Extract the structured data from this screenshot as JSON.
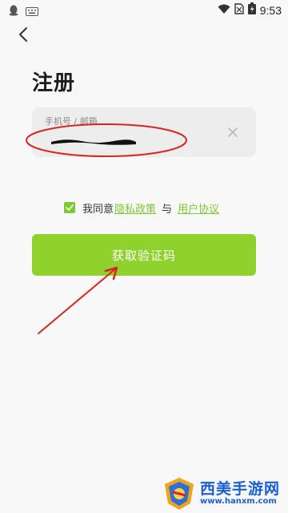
{
  "status_bar": {
    "time": "9:53"
  },
  "page": {
    "title": "注册"
  },
  "phone_input": {
    "label": "手机号 / 邮箱",
    "value": ""
  },
  "agreement": {
    "prefix": "我同意",
    "privacy_link": "隐私政策",
    "separator": "与",
    "terms_link": "用户协议",
    "checked": true
  },
  "primary_button": {
    "label": "获取验证码"
  },
  "colors": {
    "accent": "#8fd22d",
    "link": "#7dc935",
    "annotation": "#d9241f"
  },
  "watermark": {
    "name": "西美手游网",
    "url": "www.hanxm.com"
  }
}
